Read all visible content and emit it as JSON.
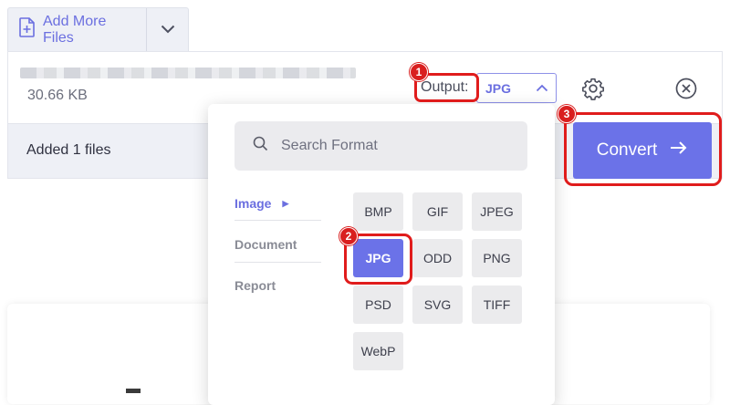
{
  "toolbar": {
    "add_more_files": "Add More Files"
  },
  "file": {
    "size": "30.66 KB",
    "output_label": "Output:",
    "output_value": "JPG"
  },
  "footer": {
    "added_text": "Added 1 files",
    "convert_label": "Convert"
  },
  "dropdown": {
    "search_placeholder": "Search Format",
    "categories": [
      {
        "label": "Image"
      },
      {
        "label": "Document"
      },
      {
        "label": "Report"
      }
    ],
    "formats": [
      {
        "label": "BMP"
      },
      {
        "label": "GIF"
      },
      {
        "label": "JPEG"
      },
      {
        "label": "JPG"
      },
      {
        "label": "ODD"
      },
      {
        "label": "PNG"
      },
      {
        "label": "PSD"
      },
      {
        "label": "SVG"
      },
      {
        "label": "TIFF"
      },
      {
        "label": "WebP"
      }
    ],
    "selected_format": "JPG"
  },
  "annotations": [
    "1",
    "2",
    "3"
  ],
  "colors": {
    "accent": "#6b72e8",
    "annotation_red": "#e01c1c"
  }
}
